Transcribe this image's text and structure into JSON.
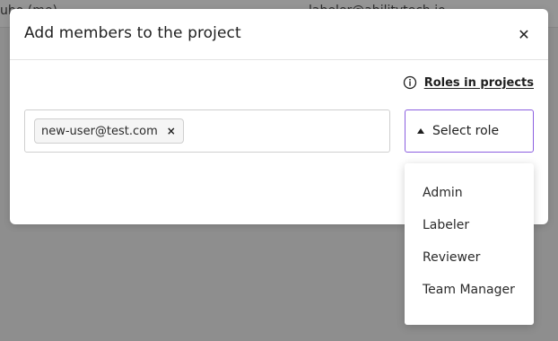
{
  "background": {
    "left_text": "ubo (me)",
    "right_text": "labeler@abilitytech.io"
  },
  "modal": {
    "title": "Add members to the project",
    "close_glyph": "✕",
    "roles_link": {
      "icon": "info-icon",
      "label": "Roles in projects"
    },
    "email_input": {
      "chips": [
        {
          "label": "new-user@test.com",
          "remove_glyph": "×"
        }
      ]
    },
    "role_select": {
      "placeholder": "Select role",
      "icon": "caret-up-icon",
      "border_color": "#8c5fe0"
    }
  },
  "role_dropdown": {
    "options": [
      "Admin",
      "Labeler",
      "Reviewer",
      "Team Manager"
    ]
  }
}
